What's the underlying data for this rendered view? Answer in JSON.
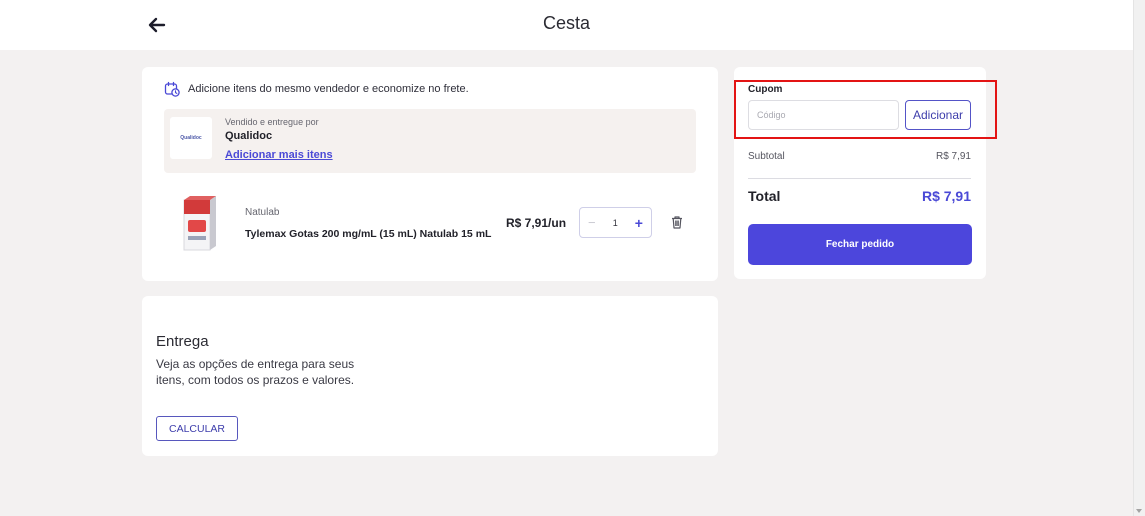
{
  "header": {
    "title": "Cesta",
    "back_icon": "arrow-left-icon"
  },
  "cart": {
    "hint": "Adicione itens do mesmo vendedor e economize no frete.",
    "seller": {
      "sold_by_label": "Vendido e entregue por",
      "name": "Qualidoc",
      "logo_text": "Qualidoc",
      "add_more_label": "Adicionar mais itens"
    },
    "item": {
      "brand": "Natulab",
      "name": "Tylemax Gotas 200 mg/mL (15 mL) Natulab 15 mL",
      "price": "R$ 7,91/un",
      "quantity": "1",
      "minus": "−",
      "plus": "+"
    }
  },
  "delivery": {
    "title": "Entrega",
    "description": "Veja as opções de entrega para seus itens, com todos os prazos e valores.",
    "button_label": "CALCULAR"
  },
  "summary": {
    "coupon_label": "Cupom",
    "coupon_placeholder": "Código",
    "coupon_button": "Adicionar",
    "subtotal_label": "Subtotal",
    "subtotal_value": "R$ 7,91",
    "total_label": "Total",
    "total_value": "R$ 7,91",
    "checkout_button": "Fechar pedido"
  },
  "colors": {
    "accent": "#4c46dc",
    "highlight_frame": "#e31414",
    "background": "#f3f1f1"
  }
}
